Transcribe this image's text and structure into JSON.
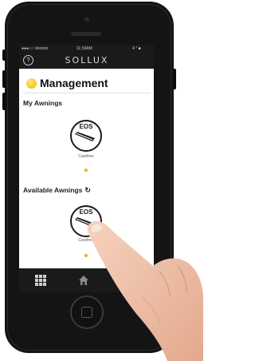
{
  "status": {
    "carrier": "●●●○○ Verizon",
    "time": "11:33AM",
    "battery": "4 * ■"
  },
  "app": {
    "help_glyph": "?",
    "brand": "SOLLUX"
  },
  "page": {
    "title": "Management"
  },
  "my_awnings": {
    "heading": "My Awnings",
    "devices": [
      {
        "brand": "EOS",
        "label": "Carefree"
      }
    ]
  },
  "available_awnings": {
    "heading": "Available Awnings",
    "refresh_glyph": "↻",
    "devices": [
      {
        "brand": "EOS",
        "label": "Carefree"
      }
    ]
  },
  "colors": {
    "accent": "#f0b400",
    "bar": "#1a1a1a"
  }
}
